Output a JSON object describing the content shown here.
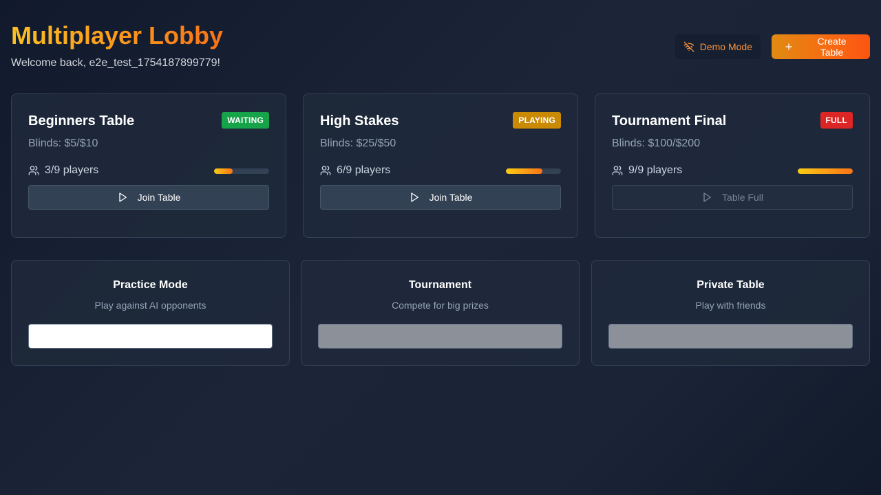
{
  "header": {
    "title": "Multiplayer Lobby",
    "welcome": "Welcome back, e2e_test_1754187899779!",
    "demo_label": "Demo Mode",
    "create_label": "Create Table",
    "demo_icon": "wifi-off-icon",
    "create_icon": "plus-icon"
  },
  "colors": {
    "waiting": "#16a34a",
    "playing": "#ca8a04",
    "full": "#dc2626",
    "accent": "#f97316"
  },
  "tables": [
    {
      "name": "Beginners Table",
      "status": "WAITING",
      "blinds": "Blinds: $5/$10",
      "players": "3/9 players",
      "fill": 0.333,
      "action": "Join Table",
      "enabled": true
    },
    {
      "name": "High Stakes",
      "status": "PLAYING",
      "blinds": "Blinds: $25/$50",
      "players": "6/9 players",
      "fill": 0.667,
      "action": "Join Table",
      "enabled": true
    },
    {
      "name": "Tournament Final",
      "status": "FULL",
      "blinds": "Blinds: $100/$200",
      "players": "9/9 players",
      "fill": 1.0,
      "action": "Table Full",
      "enabled": false
    }
  ],
  "modes": [
    {
      "title": "Practice Mode",
      "description": "Play against AI opponents",
      "button_color": "#ffffff"
    },
    {
      "title": "Tournament",
      "description": "Compete for big prizes",
      "button_color": "#8b9099"
    },
    {
      "title": "Private Table",
      "description": "Play with friends",
      "button_color": "#8b9099"
    }
  ]
}
